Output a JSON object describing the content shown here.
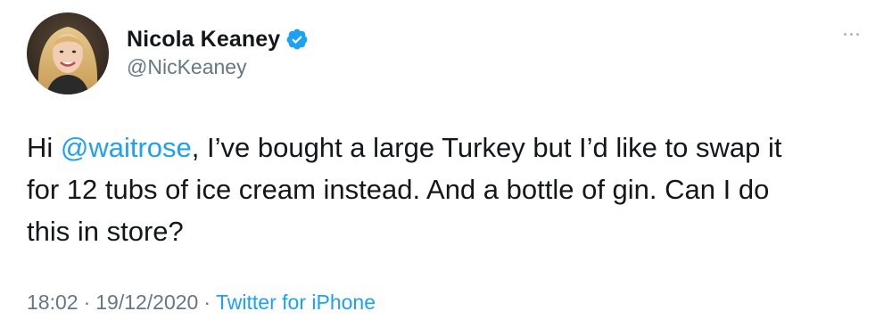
{
  "user": {
    "display_name": "Nicola Keaney",
    "handle": "@NicKeaney",
    "verified": true
  },
  "tweet": {
    "line1_prefix": "Hi ",
    "mention": "@waitrose",
    "line1_suffix": ", I’ve bought a large Turkey but I’d like to swap it",
    "line2": "for 12 tubs of ice cream instead. And a bottle of gin. Can I do",
    "line3": "this in store?"
  },
  "meta": {
    "time": "18:02",
    "separator1": "·",
    "date": "19/12/2020",
    "separator2": "·",
    "source": "Twitter for iPhone"
  },
  "icons": {
    "verified": "verified-badge-icon",
    "more": "more-options-icon"
  },
  "colors": {
    "link": "#1da1f2",
    "secondary": "#657786",
    "text": "#14171a"
  }
}
